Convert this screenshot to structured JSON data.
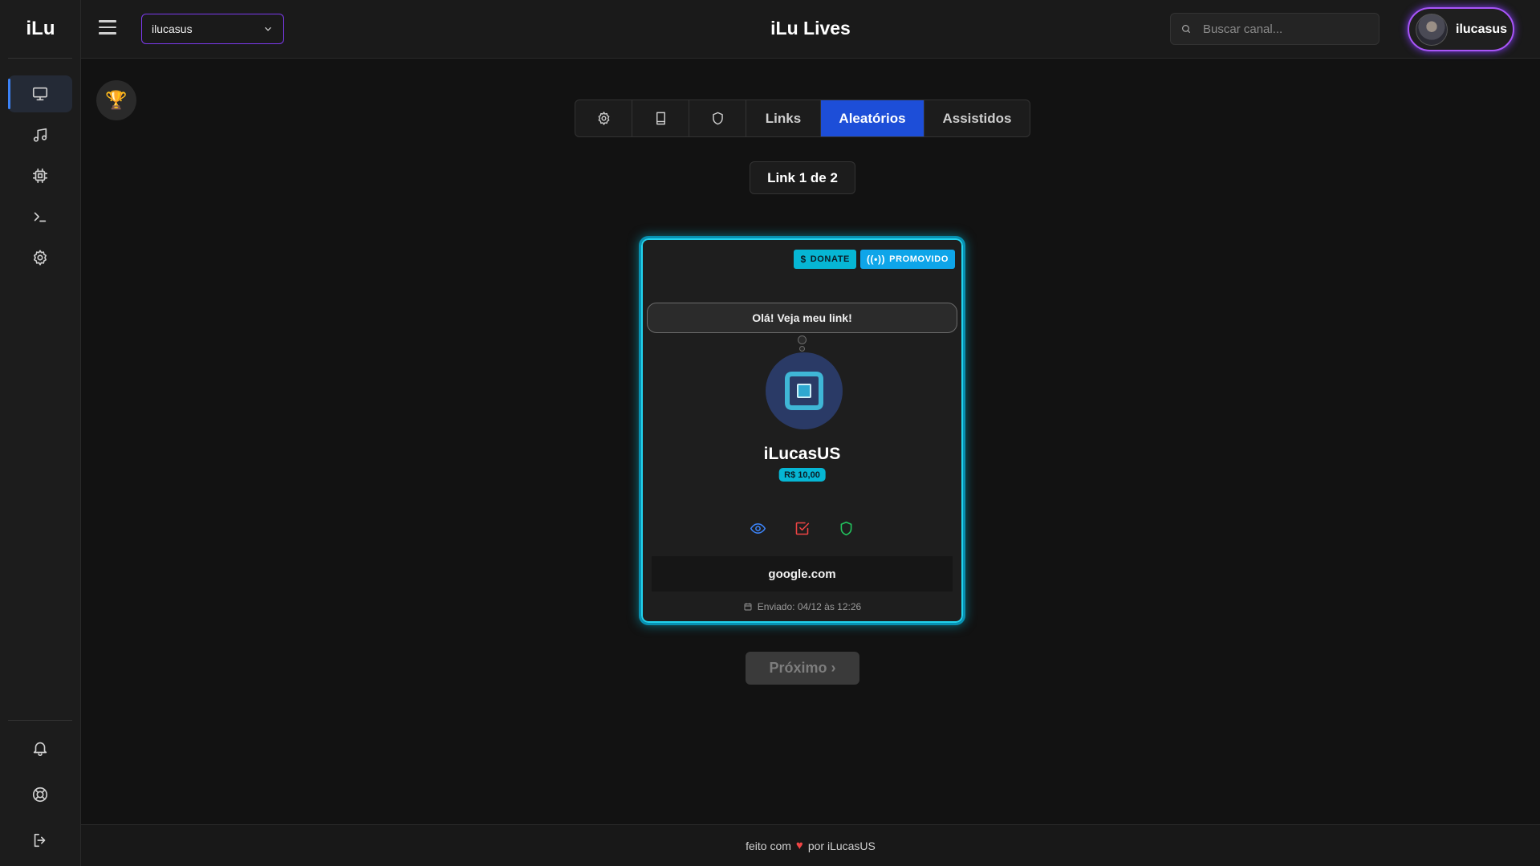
{
  "sidebar": {
    "logo": "iLu",
    "items": [
      {
        "name": "monitor-icon",
        "active": true
      },
      {
        "name": "music-icon",
        "active": false
      },
      {
        "name": "chip-icon",
        "active": false
      },
      {
        "name": "terminal-icon",
        "active": false
      },
      {
        "name": "gear-icon",
        "active": false
      }
    ],
    "bottom_items": [
      "bell-icon",
      "lifebuoy-icon",
      "logout-icon"
    ]
  },
  "header": {
    "channel_select": "ilucasus",
    "title": "iLu Lives",
    "search_placeholder": "Buscar canal...",
    "user_name": "ilucasus"
  },
  "tabs": [
    {
      "icon": "gear-icon"
    },
    {
      "icon": "book-icon"
    },
    {
      "icon": "shield-icon"
    },
    {
      "label": "Links"
    },
    {
      "label": "Aleatórios",
      "active": true
    },
    {
      "label": "Assistidos"
    }
  ],
  "counter": "Link 1 de 2",
  "card": {
    "badge_donate": "DONATE",
    "badge_promo": "PROMOVIDO",
    "message": "Olá! Veja meu link!",
    "channel_name": "iLucasUS",
    "amount": "R$ 10,00",
    "link": "google.com",
    "sent": "Enviado: 04/12 às 12:26"
  },
  "next_button": "Próximo ›",
  "footer": {
    "before": "feito com",
    "after": "por iLucasUS"
  },
  "colors": {
    "accent_blue": "#1d4ed8",
    "accent_cyan": "#06b6d4",
    "accent_purple": "#a855f7",
    "eye": "#3b82f6",
    "check": "#ef4444",
    "shield": "#22c55e"
  }
}
